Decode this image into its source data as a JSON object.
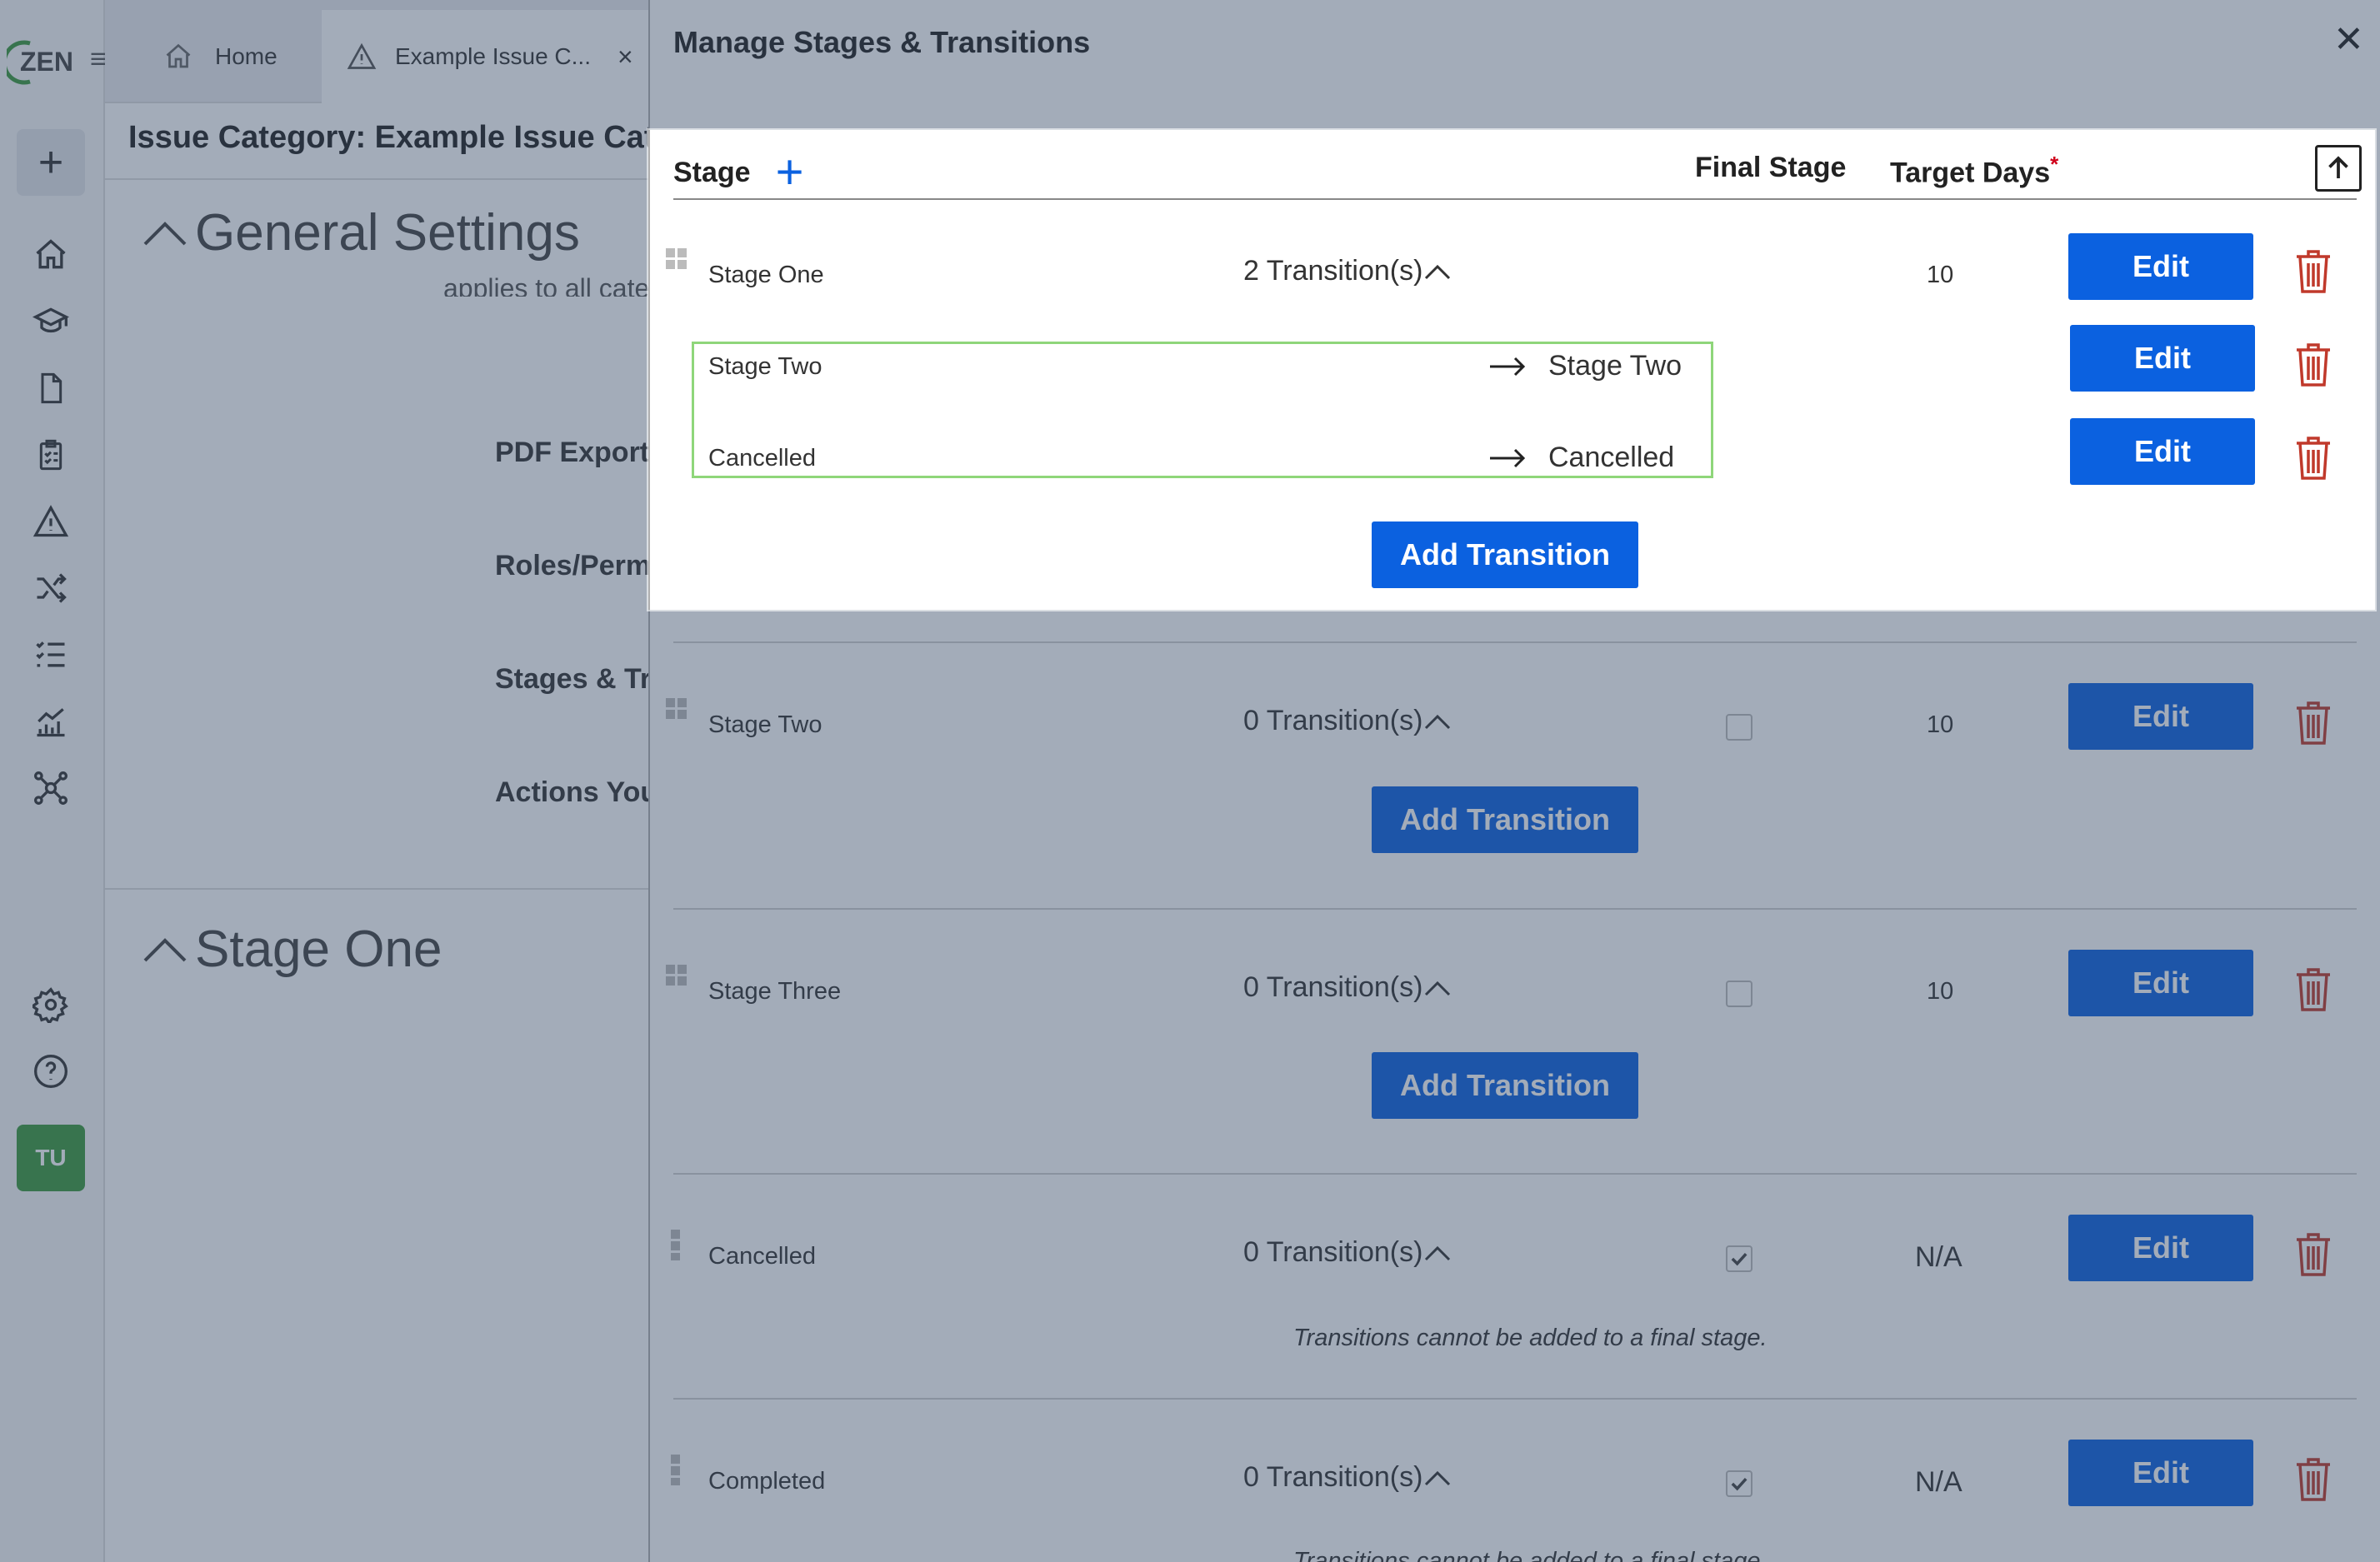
{
  "sidebar": {
    "logo_text": "ZEN",
    "menu_glyph": "≡",
    "add_glyph": "+",
    "icons": [
      "home-icon",
      "learning-icon",
      "document-icon",
      "checklist-icon",
      "warning-icon",
      "shuffle-icon",
      "list-icon",
      "analytics-icon",
      "network-icon",
      "settings-icon",
      "help-icon"
    ],
    "avatar": "TU",
    "accent": "#3c9a3c"
  },
  "tabs": [
    {
      "label": "Home",
      "icon": "home-icon"
    },
    {
      "label": "Example Issue C...",
      "icon": "warning-icon",
      "close": "×"
    }
  ],
  "page": {
    "title": "Issue Category: Example Issue Category",
    "general_settings": "General Settings",
    "partial_text": "applies to all cate",
    "sections": [
      "PDF Export C",
      "Roles/Permi",
      "Stages & Tra",
      "Actions You"
    ],
    "stage_one": "Stage One"
  },
  "modal": {
    "title": "Manage Stages & Transitions",
    "close": "✕",
    "headers": {
      "stage": "Stage",
      "add": "+",
      "final_stage": "Final Stage",
      "target_days": "Target Days",
      "required": "*"
    },
    "edit_label": "Edit",
    "add_transition_label": "Add Transition",
    "final_note": "Transitions cannot be added to a final stage.",
    "stages": [
      {
        "name": "Stage One",
        "transitions_label": "2 Transition(s)",
        "target_days": "10",
        "expanded": true,
        "transitions": [
          {
            "name": "Stage Two",
            "to": "Stage Two"
          },
          {
            "name": "Cancelled",
            "to": "Cancelled"
          }
        ]
      },
      {
        "name": "Stage Two",
        "transitions_label": "0 Transition(s)",
        "final": false,
        "target_days": "10"
      },
      {
        "name": "Stage Three",
        "transitions_label": "0 Transition(s)",
        "final": false,
        "target_days": "10"
      },
      {
        "name": "Cancelled",
        "transitions_label": "0 Transition(s)",
        "final": true,
        "target_days": "N/A"
      },
      {
        "name": "Completed",
        "transitions_label": "0 Transition(s)",
        "final": true,
        "target_days": "N/A"
      }
    ],
    "colors": {
      "primary": "#0b61e0",
      "danger": "#c0392b",
      "highlight": "#8fd67a"
    }
  }
}
